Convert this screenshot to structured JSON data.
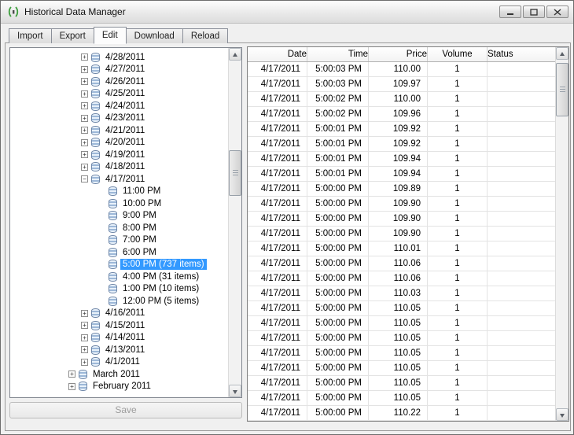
{
  "window": {
    "title": "Historical Data Manager"
  },
  "tabs": [
    {
      "label": "Import",
      "active": false
    },
    {
      "label": "Export",
      "active": false
    },
    {
      "label": "Edit",
      "active": true
    },
    {
      "label": "Download",
      "active": false
    },
    {
      "label": "Reload",
      "active": false
    }
  ],
  "tree": {
    "items": [
      {
        "label": "4/28/2011",
        "level": 2,
        "expander": "+",
        "selected": false
      },
      {
        "label": "4/27/2011",
        "level": 2,
        "expander": "+",
        "selected": false
      },
      {
        "label": "4/26/2011",
        "level": 2,
        "expander": "+",
        "selected": false
      },
      {
        "label": "4/25/2011",
        "level": 2,
        "expander": "+",
        "selected": false
      },
      {
        "label": "4/24/2011",
        "level": 2,
        "expander": "+",
        "selected": false
      },
      {
        "label": "4/23/2011",
        "level": 2,
        "expander": "+",
        "selected": false
      },
      {
        "label": "4/21/2011",
        "level": 2,
        "expander": "+",
        "selected": false
      },
      {
        "label": "4/20/2011",
        "level": 2,
        "expander": "+",
        "selected": false
      },
      {
        "label": "4/19/2011",
        "level": 2,
        "expander": "+",
        "selected": false
      },
      {
        "label": "4/18/2011",
        "level": 2,
        "expander": "+",
        "selected": false
      },
      {
        "label": "4/17/2011",
        "level": 2,
        "expander": "−",
        "selected": false
      },
      {
        "label": "11:00 PM",
        "level": 3,
        "expander": "",
        "selected": false
      },
      {
        "label": "10:00 PM",
        "level": 3,
        "expander": "",
        "selected": false
      },
      {
        "label": "9:00 PM",
        "level": 3,
        "expander": "",
        "selected": false
      },
      {
        "label": "8:00 PM",
        "level": 3,
        "expander": "",
        "selected": false
      },
      {
        "label": "7:00 PM",
        "level": 3,
        "expander": "",
        "selected": false
      },
      {
        "label": "6:00 PM",
        "level": 3,
        "expander": "",
        "selected": false
      },
      {
        "label": "5:00 PM (737 items)",
        "level": 3,
        "expander": "",
        "selected": true
      },
      {
        "label": "4:00 PM (31 items)",
        "level": 3,
        "expander": "",
        "selected": false
      },
      {
        "label": "1:00 PM (10 items)",
        "level": 3,
        "expander": "",
        "selected": false
      },
      {
        "label": "12:00 PM (5 items)",
        "level": 3,
        "expander": "",
        "selected": false
      },
      {
        "label": "4/16/2011",
        "level": 2,
        "expander": "+",
        "selected": false
      },
      {
        "label": "4/15/2011",
        "level": 2,
        "expander": "+",
        "selected": false
      },
      {
        "label": "4/14/2011",
        "level": 2,
        "expander": "+",
        "selected": false
      },
      {
        "label": "4/13/2011",
        "level": 2,
        "expander": "+",
        "selected": false
      },
      {
        "label": "4/1/2011",
        "level": 2,
        "expander": "+",
        "selected": false
      },
      {
        "label": "March 2011",
        "level": 1,
        "expander": "+",
        "selected": false
      },
      {
        "label": "February 2011",
        "level": 1,
        "expander": "+",
        "selected": false
      }
    ]
  },
  "save_button": {
    "label": "Save",
    "enabled": false
  },
  "grid": {
    "columns": [
      "Date",
      "Time",
      "Price",
      "Volume",
      "Status"
    ],
    "rows": [
      {
        "date": "4/17/2011",
        "time": "5:00:03 PM",
        "price": "110.00",
        "volume": "1",
        "status": ""
      },
      {
        "date": "4/17/2011",
        "time": "5:00:03 PM",
        "price": "109.97",
        "volume": "1",
        "status": ""
      },
      {
        "date": "4/17/2011",
        "time": "5:00:02 PM",
        "price": "110.00",
        "volume": "1",
        "status": ""
      },
      {
        "date": "4/17/2011",
        "time": "5:00:02 PM",
        "price": "109.96",
        "volume": "1",
        "status": ""
      },
      {
        "date": "4/17/2011",
        "time": "5:00:01 PM",
        "price": "109.92",
        "volume": "1",
        "status": ""
      },
      {
        "date": "4/17/2011",
        "time": "5:00:01 PM",
        "price": "109.92",
        "volume": "1",
        "status": ""
      },
      {
        "date": "4/17/2011",
        "time": "5:00:01 PM",
        "price": "109.94",
        "volume": "1",
        "status": ""
      },
      {
        "date": "4/17/2011",
        "time": "5:00:01 PM",
        "price": "109.94",
        "volume": "1",
        "status": ""
      },
      {
        "date": "4/17/2011",
        "time": "5:00:00 PM",
        "price": "109.89",
        "volume": "1",
        "status": ""
      },
      {
        "date": "4/17/2011",
        "time": "5:00:00 PM",
        "price": "109.90",
        "volume": "1",
        "status": ""
      },
      {
        "date": "4/17/2011",
        "time": "5:00:00 PM",
        "price": "109.90",
        "volume": "1",
        "status": ""
      },
      {
        "date": "4/17/2011",
        "time": "5:00:00 PM",
        "price": "109.90",
        "volume": "1",
        "status": ""
      },
      {
        "date": "4/17/2011",
        "time": "5:00:00 PM",
        "price": "110.01",
        "volume": "1",
        "status": ""
      },
      {
        "date": "4/17/2011",
        "time": "5:00:00 PM",
        "price": "110.06",
        "volume": "1",
        "status": ""
      },
      {
        "date": "4/17/2011",
        "time": "5:00:00 PM",
        "price": "110.06",
        "volume": "1",
        "status": ""
      },
      {
        "date": "4/17/2011",
        "time": "5:00:00 PM",
        "price": "110.03",
        "volume": "1",
        "status": ""
      },
      {
        "date": "4/17/2011",
        "time": "5:00:00 PM",
        "price": "110.05",
        "volume": "1",
        "status": ""
      },
      {
        "date": "4/17/2011",
        "time": "5:00:00 PM",
        "price": "110.05",
        "volume": "1",
        "status": ""
      },
      {
        "date": "4/17/2011",
        "time": "5:00:00 PM",
        "price": "110.05",
        "volume": "1",
        "status": ""
      },
      {
        "date": "4/17/2011",
        "time": "5:00:00 PM",
        "price": "110.05",
        "volume": "1",
        "status": ""
      },
      {
        "date": "4/17/2011",
        "time": "5:00:00 PM",
        "price": "110.05",
        "volume": "1",
        "status": ""
      },
      {
        "date": "4/17/2011",
        "time": "5:00:00 PM",
        "price": "110.05",
        "volume": "1",
        "status": ""
      },
      {
        "date": "4/17/2011",
        "time": "5:00:00 PM",
        "price": "110.05",
        "volume": "1",
        "status": ""
      },
      {
        "date": "4/17/2011",
        "time": "5:00:00 PM",
        "price": "110.22",
        "volume": "1",
        "status": ""
      }
    ]
  },
  "colors": {
    "selection_bg": "#3399ff",
    "selection_text": "#ffffff"
  }
}
